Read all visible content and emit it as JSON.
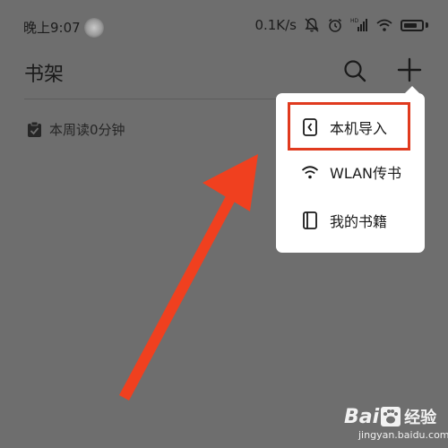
{
  "status_bar": {
    "time": "晚上9:07",
    "network_speed": "0.1K/s",
    "icons": [
      "mute-icon",
      "alarm-icon",
      "hd-signal-icon",
      "wifi-icon",
      "battery-icon"
    ],
    "signal_badge": "HD"
  },
  "header": {
    "title": "书架",
    "search_icon": "search-icon",
    "add_icon": "plus-icon"
  },
  "reading_stat": {
    "label": "本周读0分钟",
    "icon": "checklist-icon"
  },
  "popup_menu": {
    "items": [
      {
        "label": "本机导入",
        "icon": "import-file-icon",
        "highlighted": true
      },
      {
        "label": "WLAN传书",
        "icon": "wifi-icon"
      },
      {
        "label": "我的书籍",
        "icon": "book-icon"
      }
    ]
  },
  "annotation": {
    "arrow_color": "#f0401f",
    "highlight_color": "#e03a1e"
  },
  "watermark": {
    "brand_left": "Bai",
    "brand_right": "经验",
    "url": "jingyan.baidu.com"
  },
  "colors": {
    "overlay_background": "#6e6e6e",
    "popup_background": "#ffffff"
  }
}
